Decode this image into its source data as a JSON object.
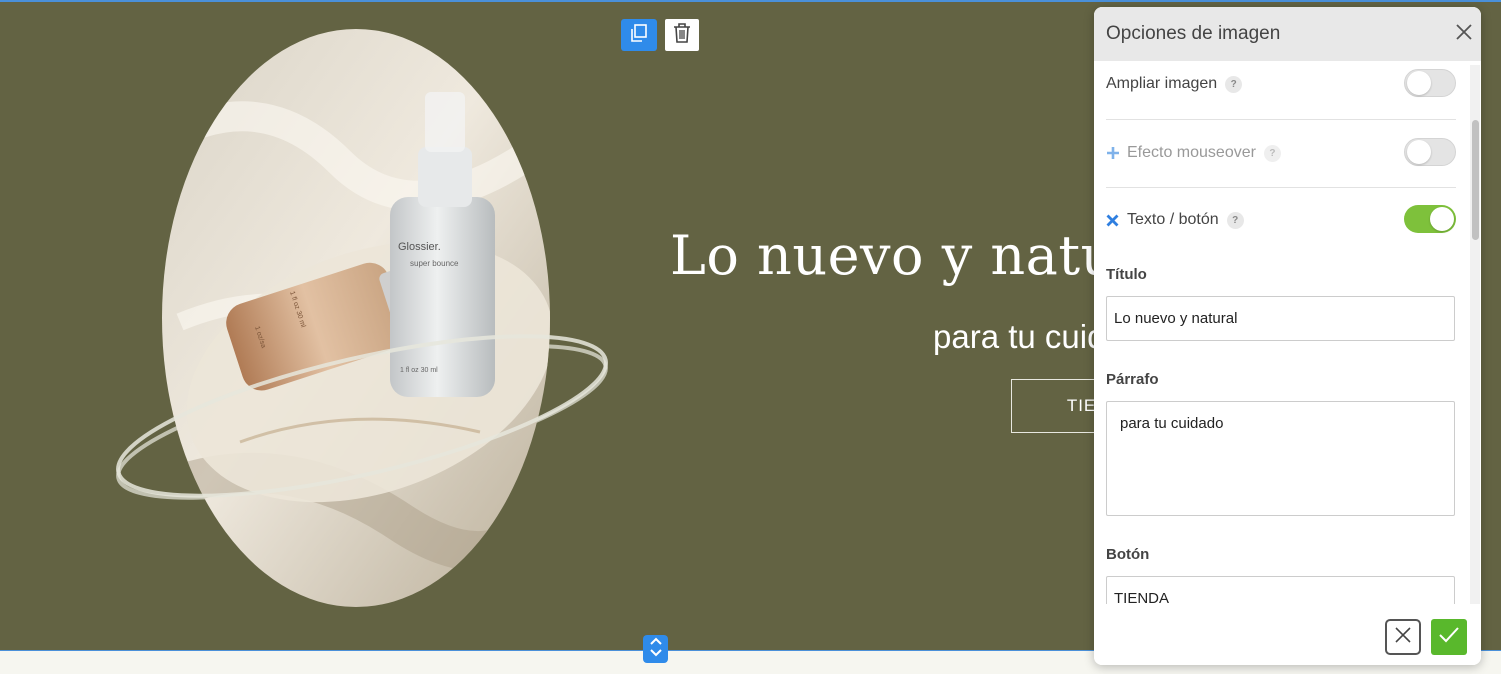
{
  "hero": {
    "title": "Lo nuevo y natural",
    "subtitle": "para tu cuidado",
    "button_label": "TIENDA",
    "background_color": "#636343"
  },
  "toolbar": {
    "copy_icon": "copy-icon",
    "delete_icon": "trash-icon",
    "accent_color": "#2f8bea"
  },
  "resize_handle_icon": "resize-vertical-icon",
  "product_image": {
    "bottle_small_brand": "Glossier.",
    "bottle_small_name": "super bounce",
    "bottle_small_volume": "1 fl oz   30 ml",
    "bottle_large_volume": "1 fl oz  30 ml",
    "bottle_large_code": "1 oz/sa"
  },
  "panel": {
    "title": "Opciones de imagen",
    "close_icon": "close-icon",
    "options": [
      {
        "label": "Ampliar imagen",
        "help": "?",
        "enabled": false,
        "muted": false,
        "lead_icon": ""
      },
      {
        "label": "Efecto mouseover",
        "help": "?",
        "enabled": false,
        "muted": true,
        "lead_icon": "plus-icon"
      },
      {
        "label": "Texto / botón",
        "help": "?",
        "enabled": true,
        "muted": false,
        "lead_icon": "x-icon"
      }
    ],
    "fields": {
      "title_label": "Título",
      "title_value": "Lo nuevo y natural",
      "paragraph_label": "Párrafo",
      "paragraph_value": "para tu cuidado",
      "button_label": "Botón",
      "button_value": "TIENDA"
    },
    "footer": {
      "cancel_icon": "close-icon",
      "confirm_icon": "checkmark-icon"
    },
    "toggle_on_color": "#7ec13b",
    "confirm_color": "#59b82c"
  }
}
